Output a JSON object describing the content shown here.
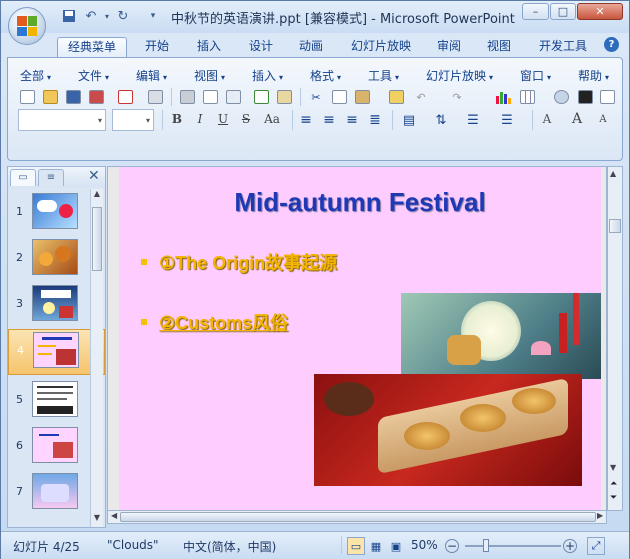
{
  "window": {
    "title": "中秋节的英语演讲.ppt [兼容模式] - Microsoft PowerPoint",
    "controls": {
      "minimize": "–",
      "maximize": "□",
      "close": "✕"
    }
  },
  "tabs": [
    "经典菜单",
    "开始",
    "插入",
    "设计",
    "动画",
    "幻灯片放映",
    "审阅",
    "视图",
    "开发工具"
  ],
  "classic_menu": [
    "全部",
    "文件",
    "编辑",
    "视图",
    "插入",
    "格式",
    "工具",
    "幻灯片放映",
    "窗口",
    "帮助"
  ],
  "format_buttons": {
    "bold": "B",
    "italic": "I",
    "underline": "U",
    "strike": "S",
    "case": "Aa",
    "fontcolor": "A",
    "grow": "A",
    "shrink": "A"
  },
  "thumbnails": {
    "tab_outline_icon": "≡",
    "items": [
      {
        "num": "1",
        "label": ""
      },
      {
        "num": "2",
        "label": ""
      },
      {
        "num": "3",
        "label": ""
      },
      {
        "num": "4",
        "label": ""
      },
      {
        "num": "5",
        "label": ""
      },
      {
        "num": "6",
        "label": ""
      },
      {
        "num": "7",
        "label": ""
      }
    ],
    "selected": "4"
  },
  "slide": {
    "title": "Mid-autumn Festival",
    "bullets": [
      "①The Origin故事起源",
      "②Customs风俗"
    ]
  },
  "status": {
    "slide_info": "幻灯片 4/25",
    "theme": "\"Clouds\"",
    "language": "中文(简体，中国)",
    "zoom": "50%",
    "zoom_minus": "−",
    "zoom_plus": "+"
  },
  "colors": {
    "title_blue": "#1f38b4",
    "bullet_gold": "#f4b400",
    "slide_bg": "#ffccff"
  }
}
